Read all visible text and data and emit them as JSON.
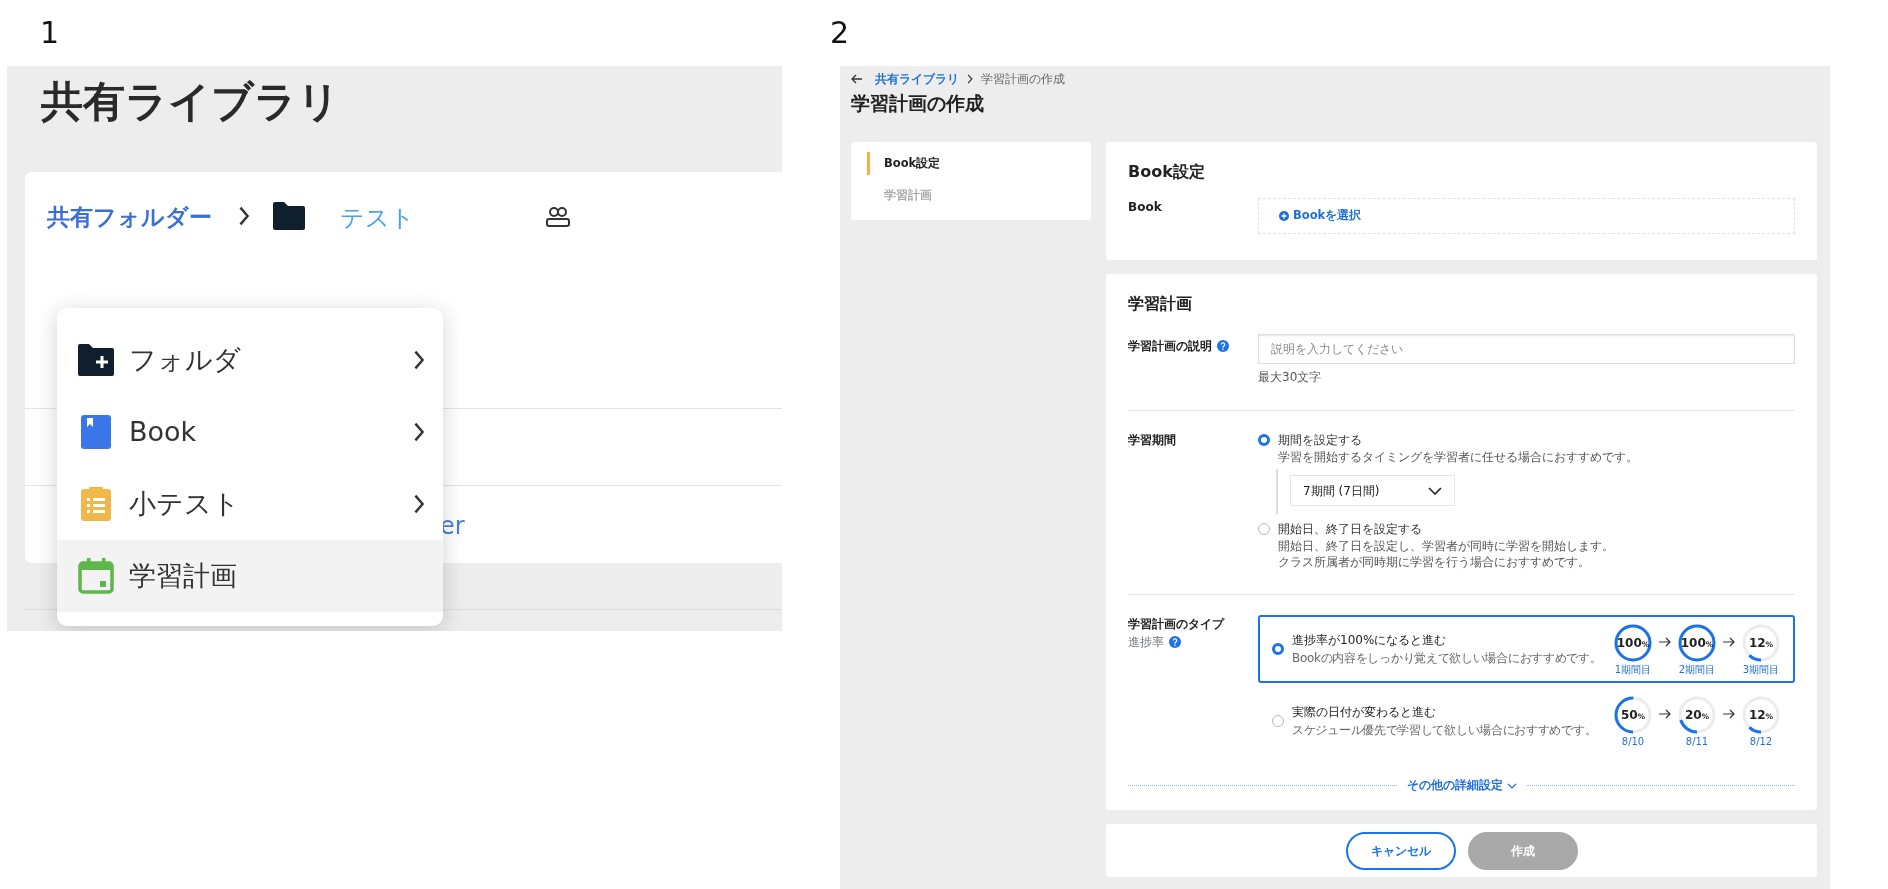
{
  "screenshot_1": {
    "number": "1",
    "title": "共有ライブラリ",
    "breadcrumb": {
      "parent": "共有フォルダー",
      "current": "テスト"
    },
    "row_text": "er",
    "menu": [
      {
        "label": "フォルダ",
        "kind": "folder-plus",
        "submenu": true,
        "selected": false
      },
      {
        "label": "Book",
        "kind": "book",
        "submenu": true,
        "selected": false
      },
      {
        "label": "小テスト",
        "kind": "quiz",
        "submenu": true,
        "selected": false
      },
      {
        "label": "学習計画",
        "kind": "calendar",
        "submenu": false,
        "selected": true
      }
    ]
  },
  "screenshot_2": {
    "number": "2",
    "breadcrumb": {
      "parent": "共有ライブラリ",
      "current": "学習計画の作成"
    },
    "title": "学習計画の作成",
    "nav": [
      {
        "label": "Book設定",
        "selected": true
      },
      {
        "label": "学習計画",
        "selected": false
      }
    ],
    "book_section": {
      "heading": "Book設定",
      "label": "Book",
      "select_link": "Bookを選択"
    },
    "plan_section": {
      "heading": "学習計画",
      "description": {
        "label": "学習計画の説明",
        "placeholder": "説明を入力してください",
        "hint": "最大30文字"
      },
      "period": {
        "label": "学習期間",
        "options": [
          {
            "label": "期間を設定する",
            "notes": [
              "学習を開始するタイミングを学習者に任せる場合におすすめです。"
            ],
            "selected": true,
            "dropdown": "7期間 (7日間)"
          },
          {
            "label": "開始日、終了日を設定する",
            "notes": [
              "開始日、終了日を設定し、学習者が同時に学習を開始します。",
              "クラス所属者が同時期に学習を行う場合におすすめです。"
            ],
            "selected": false
          }
        ]
      },
      "plan_type": {
        "label": "学習計画のタイプ",
        "sublabel": "進捗率",
        "options": [
          {
            "label": "進捗率が100%になると進む",
            "note": "Bookの内容をしっかり覚えて欲しい場合におすすめです。",
            "selected": true,
            "steps": [
              {
                "value": "100",
                "unit": "%",
                "caption": "1期間目",
                "level": 1
              },
              {
                "value": "100",
                "unit": "%",
                "caption": "2期間目",
                "level": 1
              },
              {
                "value": "12",
                "unit": "%",
                "caption": "3期間目",
                "level": 0.12
              }
            ]
          },
          {
            "label": "実際の日付が変わると進む",
            "note": "スケジュール優先で学習して欲しい場合におすすめです。",
            "selected": false,
            "steps": [
              {
                "value": "50",
                "unit": "%",
                "caption": "8/10",
                "level": 0.5
              },
              {
                "value": "20",
                "unit": "%",
                "caption": "8/11",
                "level": 0.2
              },
              {
                "value": "12",
                "unit": "%",
                "caption": "8/12",
                "level": 0.12
              }
            ]
          }
        ]
      },
      "more_settings": "その他の詳細設定"
    },
    "buttons": [
      {
        "label": "キャンセル",
        "disabled": false
      },
      {
        "label": "作成",
        "disabled": true
      }
    ]
  }
}
